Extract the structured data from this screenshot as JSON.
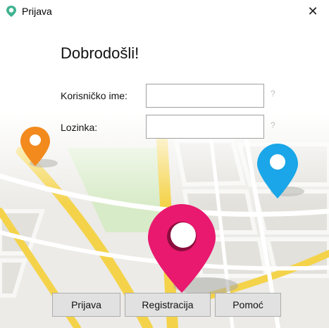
{
  "window": {
    "title": "Prijava",
    "close_glyph": "✕",
    "app_icon": "location-pin-icon"
  },
  "form": {
    "welcome": "Dobrodošli!",
    "username_label": "Korisničko ime:",
    "username_value": "",
    "password_label": "Lozinka:",
    "password_value": "",
    "help_glyph": "?"
  },
  "buttons": {
    "login": "Prijava",
    "register": "Registracija",
    "help": "Pomoć"
  },
  "colors": {
    "pin_orange": "#f28a1e",
    "pin_blue": "#1aa6e8",
    "pin_pink": "#e8196e",
    "road_yellow": "#f4d34a",
    "park_green": "#d6ebc4",
    "app_icon_teal": "#3fb28f"
  }
}
